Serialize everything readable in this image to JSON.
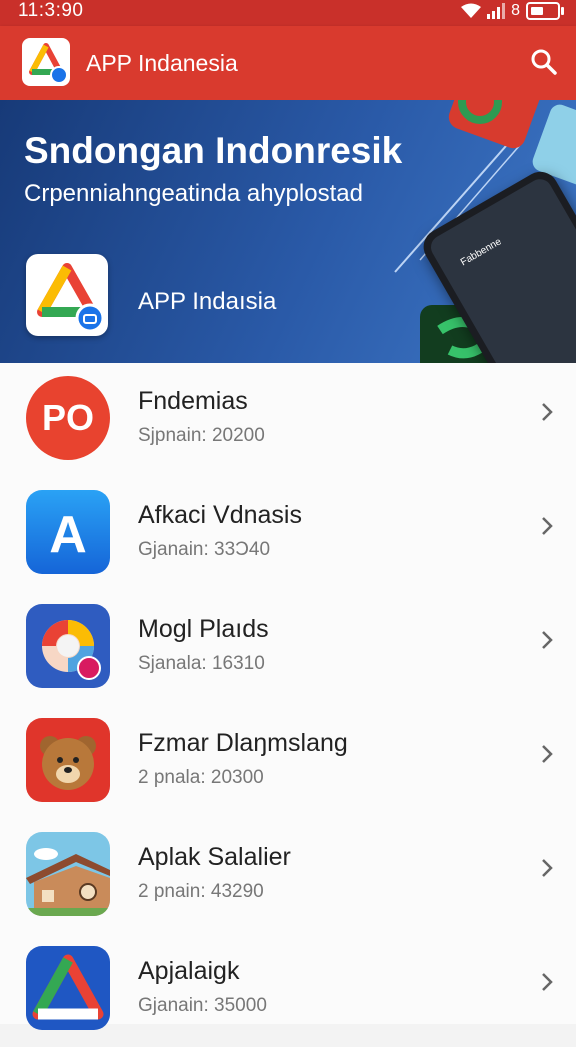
{
  "status_bar": {
    "time": "11:3:90",
    "signal_label": "8"
  },
  "app_bar": {
    "title": "APP Indanesia"
  },
  "banner": {
    "headline": "Sndongan Indonresik",
    "subtitle": "Crpenniahngeatinda ahyplostad",
    "featured_label": "APP Indaısia",
    "phone_screen_text": "Fabbenne"
  },
  "apps": [
    {
      "name": "Fndemias",
      "meta": "Sjpnain: 20200",
      "icon_text": "PO",
      "icon_name": "po-app-icon"
    },
    {
      "name": "Afkaci Vdnasis",
      "meta": "Gjanain: 33Ɔ40",
      "icon_text": "A",
      "icon_name": "a-store-app-icon"
    },
    {
      "name": "Mogl Plaıds",
      "meta": "Sjanala: 16310",
      "icon_text": "",
      "icon_name": "color-swirl-app-icon"
    },
    {
      "name": "Fzmar Dlaŋmslang",
      "meta": "2 pnala: 20300",
      "icon_text": "",
      "icon_name": "bear-app-icon"
    },
    {
      "name": "Aplak Salalier",
      "meta": "2 pnain: 43290",
      "icon_text": "",
      "icon_name": "house-app-icon"
    },
    {
      "name": "Apjalaigk",
      "meta": "Gjanain: 35000",
      "icon_text": "",
      "icon_name": "triangle-app-icon"
    }
  ]
}
